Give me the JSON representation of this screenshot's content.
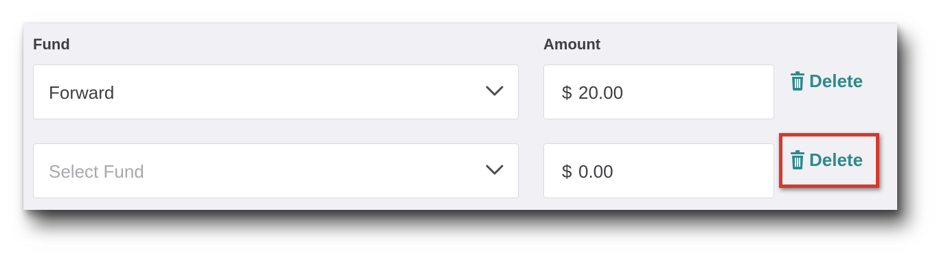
{
  "headers": {
    "fund": "Fund",
    "amount": "Amount"
  },
  "rows": [
    {
      "fund_value": "Forward",
      "fund_is_placeholder": false,
      "currency": "$",
      "amount": "20.00",
      "delete_label": "Delete"
    },
    {
      "fund_value": "Select Fund",
      "fund_is_placeholder": true,
      "currency": "$",
      "amount": "0.00",
      "delete_label": "Delete"
    }
  ],
  "icons": {
    "dropdown": "chevron-down-icon",
    "delete": "trash-icon"
  },
  "colors": {
    "accent": "#2d8a8a",
    "highlight": "#d43a2c",
    "panel_bg": "#f0f0f5"
  }
}
